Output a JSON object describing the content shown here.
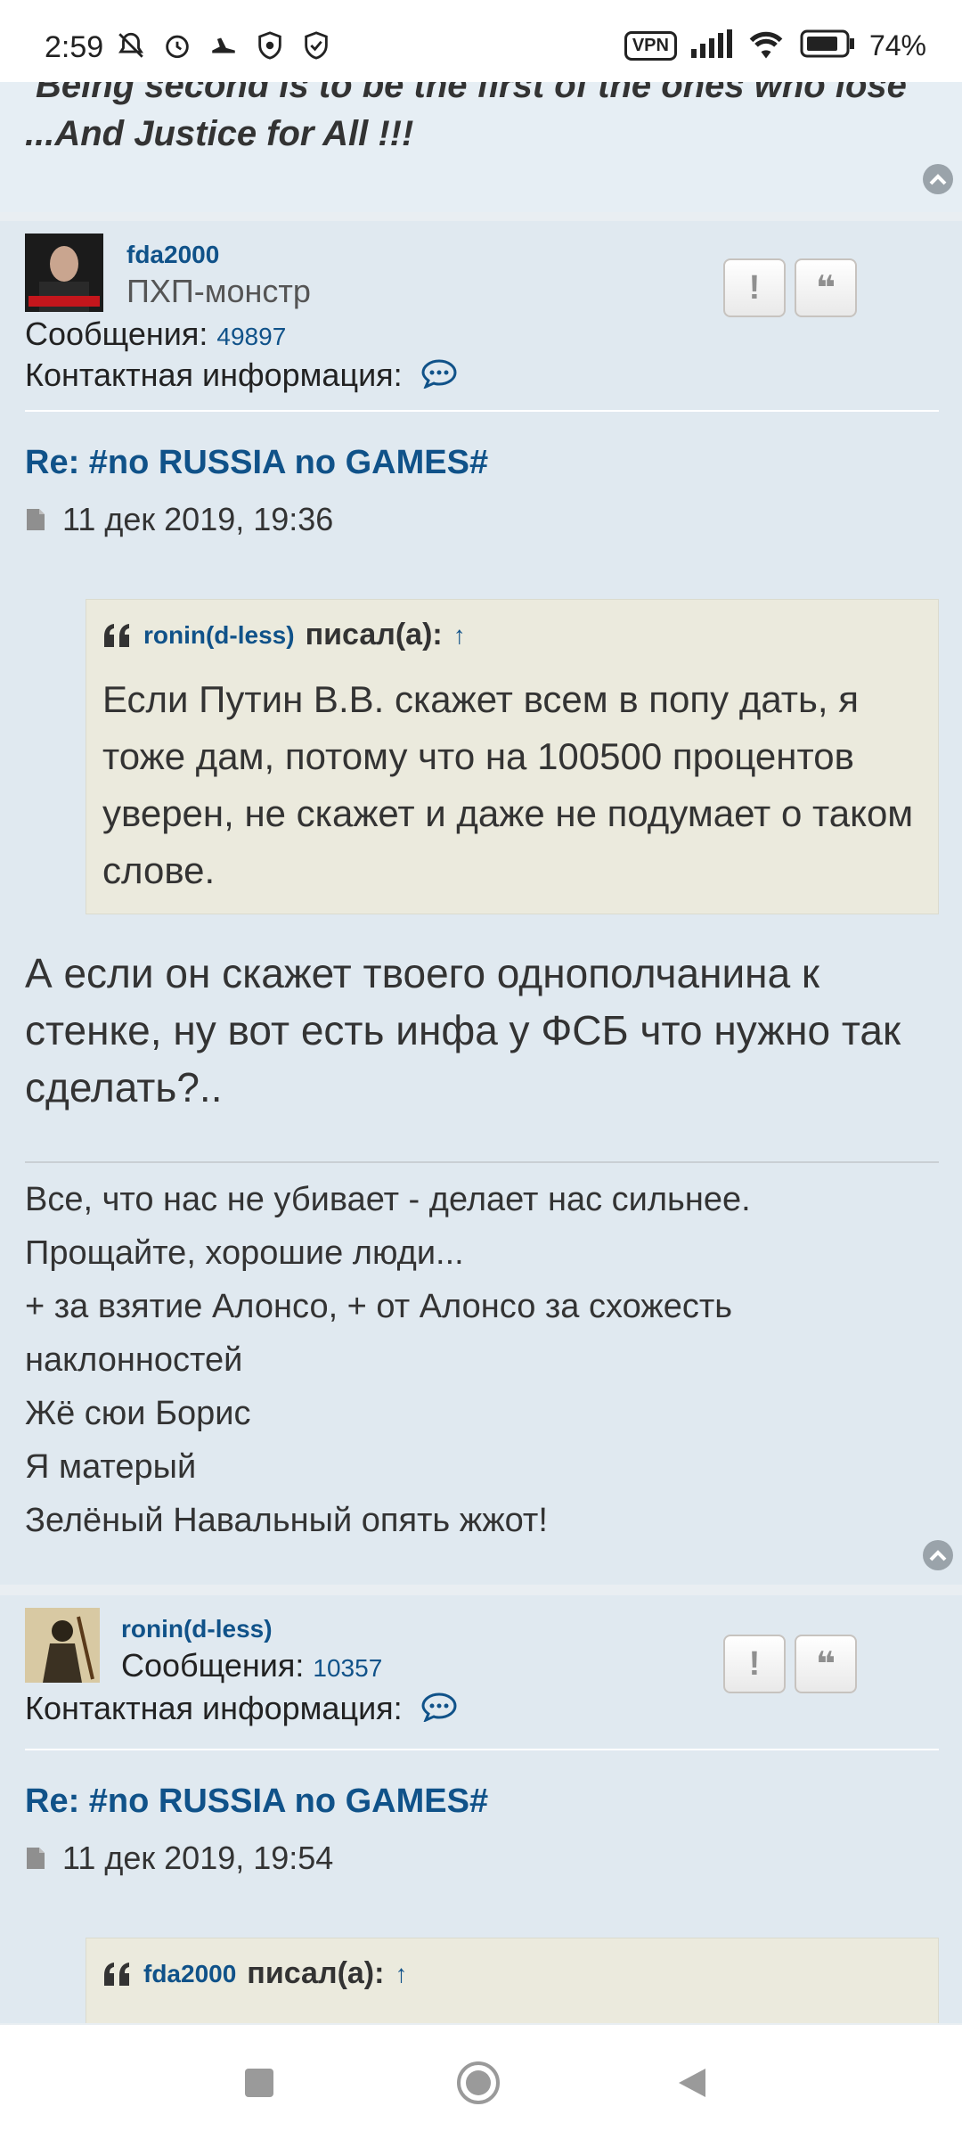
{
  "status_bar": {
    "time": "2:59",
    "vpn": "VPN",
    "battery": "74%"
  },
  "top_tail": {
    "line1": "Being second is to be the first of the ones who lose",
    "line2": "...And Justice for All !!!"
  },
  "post1": {
    "username": "fda2000",
    "rank": "ПХП-монстр",
    "messages_label": "Сообщения:",
    "messages_count": "49897",
    "contact_label": "Контактная информация:",
    "title": "Re: #no RUSSIA no GAMES#",
    "date": "11 дек 2019, 19:36",
    "quote": {
      "author": "ronin(d-less)",
      "wrote": "писал(а):",
      "arrow": "↑",
      "text": "Если Путин В.В. скажет всем в попу дать, я тоже дам, потому что на 100500 процентов уверен, не скажет и даже не подумает о таком слове."
    },
    "body": "А если он скажет твоего однополчанина к стенке, ну вот есть инфа у ФСБ что нужно так сделать?..",
    "signature": [
      "Все, что нас не убивает - делает нас сильнее.",
      "Прощайте, хорошие люди...",
      "+ за взятие Алонсо, + от Алонсо за схожесть наклонностей",
      "Жё сюи Борис",
      "Я матерый",
      "Зелёный Навальный опять жжот!"
    ]
  },
  "post2": {
    "username": "ronin(d-less)",
    "messages_label": "Сообщения:",
    "messages_count": "10357",
    "contact_label": "Контактная информация:",
    "title": "Re: #no RUSSIA no GAMES#",
    "date": "11 дек 2019, 19:54",
    "quote": {
      "author": "fda2000",
      "wrote": "писал(а):",
      "arrow": "↑"
    }
  },
  "buttons": {
    "report": "!",
    "quote": "❝"
  },
  "colors": {
    "link": "#105289",
    "post_bg": "#e0e9f0",
    "quote_bg": "#ebeadd"
  }
}
